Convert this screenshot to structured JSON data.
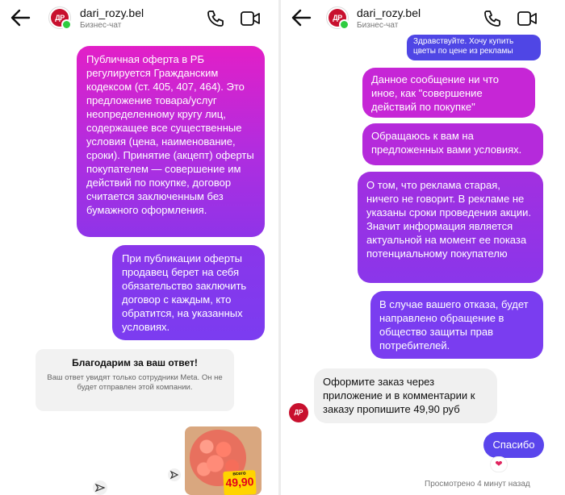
{
  "header": {
    "username": "dari_rozy.bel",
    "subtitle": "Бизнес-чат",
    "avatar_logo": "ДР"
  },
  "left": {
    "messages": [
      "Публичная оферта в РБ регулируется Гражданским кодексом (ст. 405, 407, 464). Это предложение товара/услуг неопределенному кругу лиц, содержащее все существенные условия (цена, наименование, сроки). Принятие (акцепт) оферты покупателем — совершение им действий по покупке, договор считается заключенным без бумажного оформления.",
      "При публикации оферты продавец берет на себя обязательство заключить договор с каждым, кто обратится, на указанных условиях."
    ],
    "notice": {
      "title": "Благодарим за ваш ответ!",
      "body": "Ваш ответ увидят только сотрудники Meta. Он не будет отправлен этой компании."
    },
    "promo": {
      "label": "всего",
      "price": "49,90"
    }
  },
  "right": {
    "messages": [
      "Здравствуйте. Хочу купить цветы по цене из рекламы",
      "Данное сообщение ни что иное, как \"совершение действий по покупке\"",
      "Обращаюсь к вам на предложенных вами условиях.",
      "О том, что реклама старая, ничего не говорит. В рекламе не указаны сроки проведения акции. Значит информация является актуальной на момент ее показа потенциальному покупателю",
      "В случае вашего отказа, будет направлено обращение в общество защиты прав потребителей."
    ],
    "reply": "Оформите заказ через приложение и в комментарии к заказу пропишите 49,90 руб",
    "last_message": "Спасибо",
    "reaction": "❤",
    "seen": "Просмотрено 4 минут назад"
  },
  "colors": {
    "bubble_magenta": "#e21fc7",
    "bubble_purple": "#7b3cf0",
    "bubble_blue": "#4f46e5",
    "brand_red": "#c8102e",
    "online_green": "#2ecc40"
  },
  "icons": [
    "back-arrow-icon",
    "phone-icon",
    "video-camera-icon",
    "share-icon",
    "heart-icon"
  ]
}
